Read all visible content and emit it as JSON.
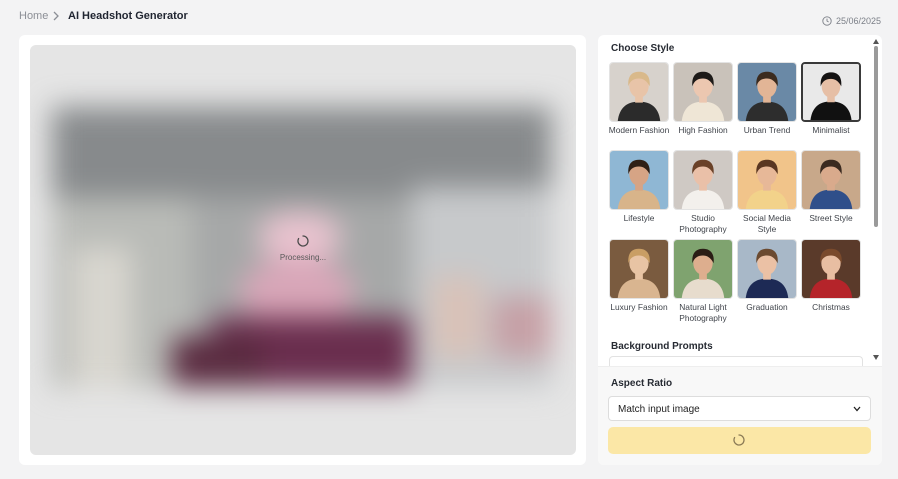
{
  "breadcrumb": {
    "home": "Home",
    "separator_icon": "chevron-right-icon",
    "current": "AI Headshot Generator"
  },
  "date": {
    "icon": "clock-icon",
    "text": "25/06/2025"
  },
  "preview": {
    "status_text": "Processing...",
    "spinner_icon": "spinner-icon"
  },
  "style_panel": {
    "title": "Choose Style",
    "selected": "Minimalist",
    "styles": [
      {
        "label": "Modern Fashion",
        "skin": "#e8c4a8",
        "hair": "#d9b98a",
        "top": "#2b2b2b",
        "bg": "#d7d2cc"
      },
      {
        "label": "High Fashion",
        "skin": "#ecc7b0",
        "hair": "#1d1a18",
        "top": "#efe6d6",
        "bg": "#c9c2ba"
      },
      {
        "label": "Urban Trend",
        "skin": "#e2b596",
        "hair": "#3b2b1e",
        "top": "#2d2d2d",
        "bg": "#6a89a6"
      },
      {
        "label": "Minimalist",
        "skin": "#e6bfa6",
        "hair": "#151313",
        "top": "#111111",
        "bg": "#e9e9e9"
      },
      {
        "label": "Lifestyle",
        "skin": "#d6a485",
        "hair": "#2f2016",
        "top": "#d8b48a",
        "bg": "#8fb7d4"
      },
      {
        "label": "Studio Photography",
        "skin": "#eac0a8",
        "hair": "#6a4128",
        "top": "#f3f0ec",
        "bg": "#cfc9c4"
      },
      {
        "label": "Social Media Style",
        "skin": "#e7b898",
        "hair": "#5a3722",
        "top": "#f2d28a",
        "bg": "#f1c48a"
      },
      {
        "label": "Street Style",
        "skin": "#d9aa8c",
        "hair": "#3a2a20",
        "top": "#2f4f8a",
        "bg": "#c8a88a"
      },
      {
        "label": "Luxury Fashion",
        "skin": "#e8c4a4",
        "hair": "#c99e64",
        "top": "#d9b590",
        "bg": "#7a5b3f"
      },
      {
        "label": "Natural Light Photography",
        "skin": "#ddae8e",
        "hair": "#2a1d15",
        "top": "#e7dccd",
        "bg": "#7fa36f"
      },
      {
        "label": "Graduation",
        "skin": "#ebc1a5",
        "hair": "#6b4a30",
        "top": "#1d2a55",
        "bg": "#a8b8c8"
      },
      {
        "label": "Christmas",
        "skin": "#e8bea2",
        "hair": "#7a4a2c",
        "top": "#b5242a",
        "bg": "#5a3a2a"
      }
    ],
    "background_title": "Background Prompts"
  },
  "scrollbar": {
    "up_icon": "arrow-up-icon",
    "down_icon": "arrow-down-icon"
  },
  "aspect_ratio": {
    "label": "Aspect Ratio",
    "value": "Match input image",
    "chevron_icon": "chevron-down-icon"
  },
  "generate_button": {
    "spinner_icon": "spinner-icon",
    "color": "#fbe7a6"
  }
}
